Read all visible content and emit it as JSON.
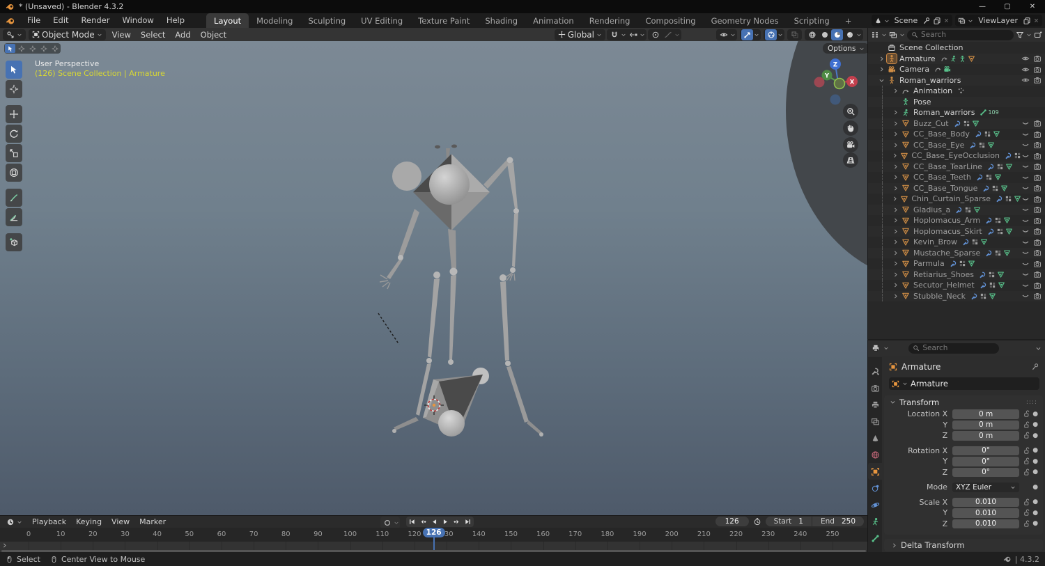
{
  "window": {
    "title": "* (Unsaved) - Blender 4.3.2",
    "controls": [
      "minimize",
      "maximize",
      "close"
    ]
  },
  "colors": {
    "accent_blue": "#4772b3",
    "object_orange": "#e8963f",
    "data_green": "#58c08a",
    "modifier_blue": "#6292d6",
    "overlay_yellow": "#d8d833"
  },
  "topbar": {
    "menus": [
      "File",
      "Edit",
      "Render",
      "Window",
      "Help"
    ],
    "workspaces": [
      "Layout",
      "Modeling",
      "Sculpting",
      "UV Editing",
      "Texture Paint",
      "Shading",
      "Animation",
      "Rendering",
      "Compositing",
      "Geometry Nodes",
      "Scripting"
    ],
    "active_workspace": "Layout",
    "add_tab": "+",
    "scene_selector": {
      "label": "Scene"
    },
    "viewlayer_selector": {
      "label": "ViewLayer"
    }
  },
  "viewport_header": {
    "mode": "Object Mode",
    "menus": [
      "View",
      "Select",
      "Add",
      "Object"
    ],
    "orientation": "Global",
    "toggle_groups": [
      {
        "items": [
          {
            "icon": "vis-eye",
            "chev": true
          }
        ]
      },
      {
        "items": [
          {
            "icon": "gizmo-arrow",
            "active": true,
            "chev": true
          }
        ]
      },
      {
        "items": [
          {
            "icon": "overlay",
            "active": true,
            "chev": true
          }
        ]
      },
      {
        "items": [
          {
            "icon": "xray",
            "disabled": true
          }
        ]
      },
      {
        "items": [
          {
            "icon": "wire-sphere"
          },
          {
            "icon": "sphere"
          },
          {
            "icon": "sphere-mat",
            "active": true
          },
          {
            "icon": "sphere-r"
          },
          {
            "icon": "",
            "chev": true
          }
        ]
      }
    ]
  },
  "viewport": {
    "options_label": "Options",
    "overlay_line1": "User Perspective",
    "overlay_line2": "(126) Scene Collection | Armature",
    "gizmo_axes": [
      "Z",
      "Y",
      "X"
    ],
    "nav_buttons": [
      "zoom",
      "pan",
      "camera",
      "ortho-grid"
    ],
    "toolbar": [
      {
        "id": "select-box",
        "active": true
      },
      {
        "id": "cursor"
      },
      {
        "id": "move",
        "gap": true
      },
      {
        "id": "rotate"
      },
      {
        "id": "scale"
      },
      {
        "id": "transform"
      },
      {
        "id": "annotate",
        "gap": true
      },
      {
        "id": "measure"
      },
      {
        "id": "add-cube",
        "gap": true
      }
    ],
    "select_modes": [
      "tweak",
      "box",
      "extend",
      "subtract",
      "intersect"
    ]
  },
  "outliner": {
    "search_placeholder": "Search",
    "rows": [
      {
        "name": "Scene Collection",
        "icon": "collection",
        "color": "lgray",
        "indent": 0,
        "exp": "",
        "badges": [],
        "vis": ""
      },
      {
        "name": "Armature",
        "icon": "person",
        "color": "orange",
        "indent": 0,
        "exp": "r",
        "selected": true,
        "badges": [
          "action",
          "runner",
          "pose",
          "tri-orange"
        ],
        "vis": "eye"
      },
      {
        "name": "Camera",
        "icon": "camera-obj",
        "color": "orange",
        "indent": 0,
        "exp": "r",
        "badges": [
          "action",
          "camera-green"
        ],
        "vis": "eye"
      },
      {
        "name": "Roman_warriors",
        "icon": "person",
        "color": "orange",
        "indent": 0,
        "exp": "d",
        "badges": [],
        "vis": "eye"
      },
      {
        "name": "Animation",
        "icon": "action",
        "color": "gray",
        "indent": 1,
        "exp": "r",
        "badges": [
          "keys"
        ],
        "vis": ""
      },
      {
        "name": "Pose",
        "icon": "pose",
        "color": "green",
        "indent": 1,
        "exp": "",
        "badges": [],
        "vis": ""
      },
      {
        "name": "Roman_warriors",
        "icon": "runner",
        "color": "green",
        "indent": 1,
        "exp": "r",
        "badges": [
          "bone"
        ],
        "badge_text": "109",
        "vis": ""
      },
      {
        "name": "Buzz_Cut",
        "icon": "tri",
        "color": "orange",
        "indent": 1,
        "exp": "r",
        "dim": true,
        "badges": [
          "wrench",
          "material",
          "tri-green"
        ],
        "vis": "closed"
      },
      {
        "name": "CC_Base_Body",
        "icon": "tri",
        "color": "orange",
        "indent": 1,
        "exp": "r",
        "dim": true,
        "badges": [
          "wrench",
          "material",
          "tri-green"
        ],
        "vis": "closed"
      },
      {
        "name": "CC_Base_Eye",
        "icon": "tri",
        "color": "orange",
        "indent": 1,
        "exp": "r",
        "dim": true,
        "badges": [
          "wrench",
          "material",
          "tri-green"
        ],
        "vis": "closed"
      },
      {
        "name": "CC_Base_EyeOcclusion",
        "icon": "tri",
        "color": "orange",
        "indent": 1,
        "exp": "r",
        "dim": true,
        "badges": [
          "wrench",
          "material"
        ],
        "vis": "closed"
      },
      {
        "name": "CC_Base_TearLine",
        "icon": "tri",
        "color": "orange",
        "indent": 1,
        "exp": "r",
        "dim": true,
        "badges": [
          "wrench",
          "material",
          "tri-green"
        ],
        "vis": "closed"
      },
      {
        "name": "CC_Base_Teeth",
        "icon": "tri",
        "color": "orange",
        "indent": 1,
        "exp": "r",
        "dim": true,
        "badges": [
          "wrench",
          "material",
          "tri-green"
        ],
        "vis": "closed"
      },
      {
        "name": "CC_Base_Tongue",
        "icon": "tri",
        "color": "orange",
        "indent": 1,
        "exp": "r",
        "dim": true,
        "badges": [
          "wrench",
          "material",
          "tri-green"
        ],
        "vis": "closed"
      },
      {
        "name": "Chin_Curtain_Sparse",
        "icon": "tri",
        "color": "orange",
        "indent": 1,
        "exp": "r",
        "dim": true,
        "badges": [
          "wrench",
          "material",
          "tri-green"
        ],
        "vis": "closed"
      },
      {
        "name": "Gladius_a",
        "icon": "tri",
        "color": "orange",
        "indent": 1,
        "exp": "r",
        "dim": true,
        "badges": [
          "wrench",
          "material",
          "tri-green"
        ],
        "vis": "closed"
      },
      {
        "name": "Hoplomacus_Arm",
        "icon": "tri",
        "color": "orange",
        "indent": 1,
        "exp": "r",
        "dim": true,
        "badges": [
          "wrench",
          "material",
          "tri-green"
        ],
        "vis": "closed"
      },
      {
        "name": "Hoplomacus_Skirt",
        "icon": "tri",
        "color": "orange",
        "indent": 1,
        "exp": "r",
        "dim": true,
        "badges": [
          "wrench",
          "material",
          "tri-green"
        ],
        "vis": "closed"
      },
      {
        "name": "Kevin_Brow",
        "icon": "tri",
        "color": "orange",
        "indent": 1,
        "exp": "r",
        "dim": true,
        "badges": [
          "wrench",
          "material",
          "tri-green"
        ],
        "vis": "closed"
      },
      {
        "name": "Mustache_Sparse",
        "icon": "tri",
        "color": "orange",
        "indent": 1,
        "exp": "r",
        "dim": true,
        "badges": [
          "wrench",
          "material",
          "tri-green"
        ],
        "vis": "closed"
      },
      {
        "name": "Parmula",
        "icon": "tri",
        "color": "orange",
        "indent": 1,
        "exp": "r",
        "dim": true,
        "badges": [
          "wrench",
          "material",
          "tri-green"
        ],
        "vis": "closed"
      },
      {
        "name": "Retiarius_Shoes",
        "icon": "tri",
        "color": "orange",
        "indent": 1,
        "exp": "r",
        "dim": true,
        "badges": [
          "wrench",
          "material",
          "tri-green"
        ],
        "vis": "closed"
      },
      {
        "name": "Secutor_Helmet",
        "icon": "tri",
        "color": "orange",
        "indent": 1,
        "exp": "r",
        "dim": true,
        "badges": [
          "wrench",
          "material",
          "tri-green"
        ],
        "vis": "closed"
      },
      {
        "name": "Stubble_Neck",
        "icon": "tri",
        "color": "orange",
        "indent": 1,
        "exp": "r",
        "dim": true,
        "badges": [
          "wrench",
          "material",
          "tri-green"
        ],
        "vis": "closed"
      }
    ]
  },
  "properties": {
    "search_placeholder": "Search",
    "tabs": [
      {
        "id": "tool"
      },
      {
        "id": "render"
      },
      {
        "id": "output"
      },
      {
        "id": "viewlayer"
      },
      {
        "id": "scene"
      },
      {
        "id": "world",
        "tint": "#c06576"
      },
      {
        "id": "object",
        "active": true,
        "tint": "#e8963f"
      },
      {
        "id": "constraint",
        "tint": "#6292d6"
      },
      {
        "id": "physics",
        "tint": "#6292d6"
      },
      {
        "id": "data",
        "tint": "#58c08a"
      },
      {
        "id": "bone",
        "tint": "#58c08a"
      }
    ],
    "breadcrumb": "Armature",
    "object_name": "Armature",
    "transform": {
      "title": "Transform",
      "rows": [
        {
          "label": "Location X",
          "value": "0 m",
          "lock": true
        },
        {
          "label": "Y",
          "value": "0 m",
          "lock": true
        },
        {
          "label": "Z",
          "value": "0 m",
          "lock": true
        },
        {
          "label": "Rotation X",
          "value": "0°",
          "lock": true,
          "gap": true
        },
        {
          "label": "Y",
          "value": "0°",
          "lock": true
        },
        {
          "label": "Z",
          "value": "0°",
          "lock": true
        },
        {
          "label": "Mode",
          "value": "XYZ Euler",
          "dropdown": true,
          "gap": true
        },
        {
          "label": "Scale X",
          "value": "0.010",
          "lock": true,
          "gap": true
        },
        {
          "label": "Y",
          "value": "0.010",
          "lock": true
        },
        {
          "label": "Z",
          "value": "0.010",
          "lock": true
        }
      ],
      "delta_label": "Delta Transform"
    }
  },
  "timeline": {
    "menus": [
      "Playback",
      "Keying",
      "View",
      "Marker"
    ],
    "transport": [
      "jump-first",
      "prev-key",
      "play-rev",
      "play",
      "next-key",
      "jump-last"
    ],
    "current_frame": "126",
    "frame_start_label": "Start",
    "frame_start": "1",
    "frame_end_label": "End",
    "frame_end": "250",
    "tick_start": 0,
    "tick_end": 250,
    "tick_step": 10
  },
  "statusbar": {
    "hints": [
      {
        "icon": "mouse-left",
        "label": "Select"
      },
      {
        "icon": "mouse-middle",
        "label": "Center View to Mouse"
      }
    ],
    "version": "| 4.3.2"
  }
}
